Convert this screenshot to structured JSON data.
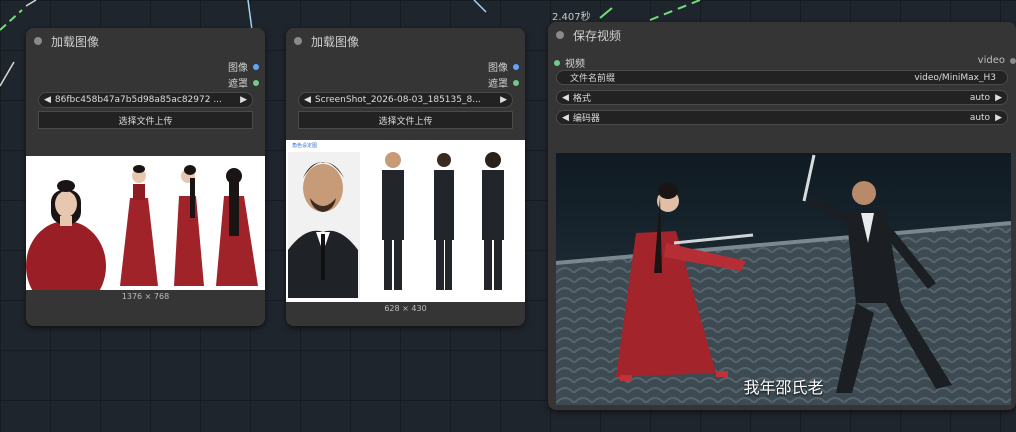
{
  "nodes": {
    "load1": {
      "title": "加载图像",
      "outputs": {
        "image": "图像",
        "mask": "遮罩"
      },
      "file": "86fbc458b47a7b5d98a85ac82972 ...",
      "upload": "选择文件上传",
      "size": "1376 × 768"
    },
    "load2": {
      "title": "加载图像",
      "outputs": {
        "image": "图像",
        "mask": "遮罩"
      },
      "file": "ScreenShot_2026-08-03_185135_8...",
      "upload": "选择文件上传",
      "size": "628 × 430",
      "sheet_tag": "角色设定图"
    },
    "save": {
      "title": "保存视频",
      "timer": "2.407秒",
      "input_label": "视频",
      "output_label": "video",
      "widgets": {
        "prefix": {
          "label": "文件名前缀",
          "value": "video/MiniMax_H3"
        },
        "format": {
          "label": "格式",
          "value": "auto"
        },
        "codec": {
          "label": "编码器",
          "value": "auto"
        }
      },
      "subtitle": "我年邵氏老"
    }
  },
  "colors": {
    "canvas": "#1f252c",
    "node": "#353535",
    "image_slot": "#5fa6ff",
    "mask_slot": "#72c98a",
    "wire_green": "#6ee07a",
    "wire_blue": "#9fd8f5"
  }
}
